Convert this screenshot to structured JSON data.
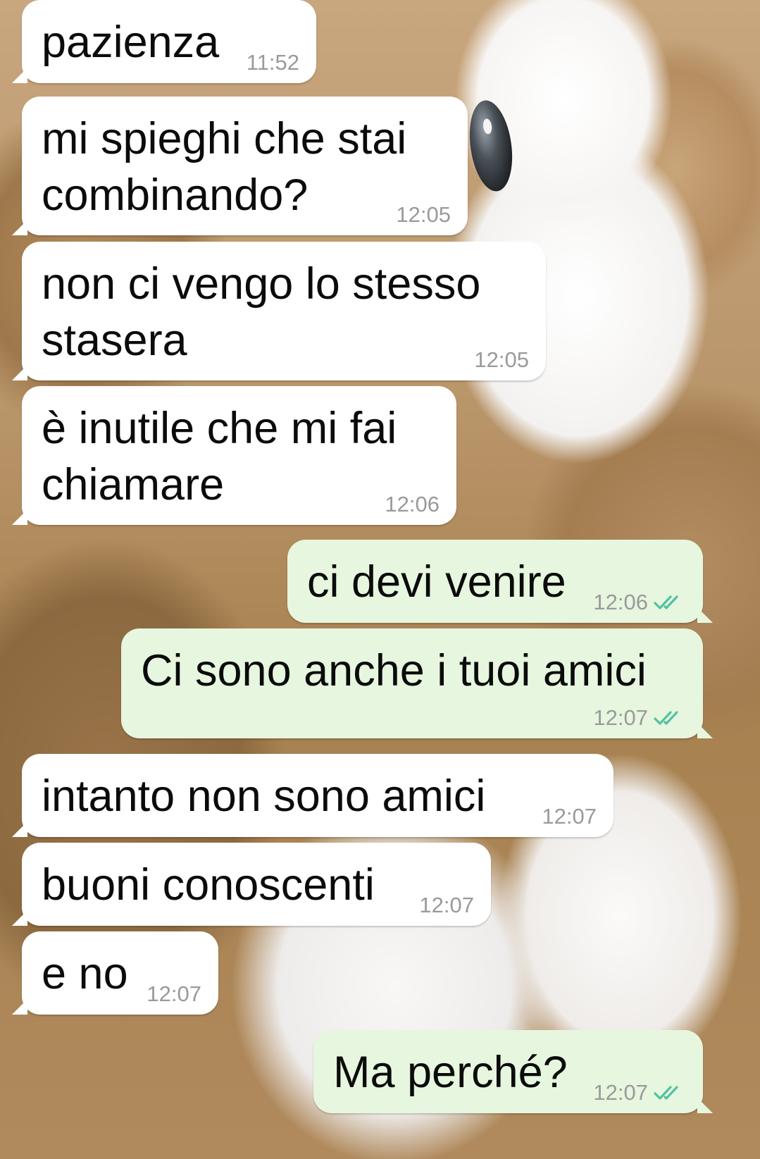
{
  "messages": [
    {
      "dir": "in",
      "text": "pazienza",
      "time": "11:52"
    },
    {
      "dir": "in",
      "text": "mi spieghi che stai\ncombinando?",
      "time": "12:05"
    },
    {
      "dir": "in",
      "text": "non ci vengo lo stesso\nstasera",
      "time": "12:05"
    },
    {
      "dir": "in",
      "text": "è inutile che mi fai\nchiamare",
      "time": "12:06"
    },
    {
      "dir": "out",
      "text": "ci devi venire",
      "time": "12:06",
      "status": "read"
    },
    {
      "dir": "out",
      "text": "Ci sono anche i tuoi amici",
      "time": "12:07",
      "status": "read"
    },
    {
      "dir": "in",
      "text": "intanto non sono amici",
      "time": "12:07"
    },
    {
      "dir": "in",
      "text": "buoni conoscenti",
      "time": "12:07"
    },
    {
      "dir": "in",
      "text": "e no",
      "time": "12:07"
    },
    {
      "dir": "out",
      "text": "Ma perché?",
      "time": "12:07",
      "status": "read"
    }
  ],
  "colors": {
    "incoming_bubble": "#ffffff",
    "outgoing_bubble": "#e7f6df",
    "read_ticks": "#4fc3a1",
    "timestamp": "#9a9a9a"
  },
  "icons": {
    "read_status": "double-check-icon"
  }
}
